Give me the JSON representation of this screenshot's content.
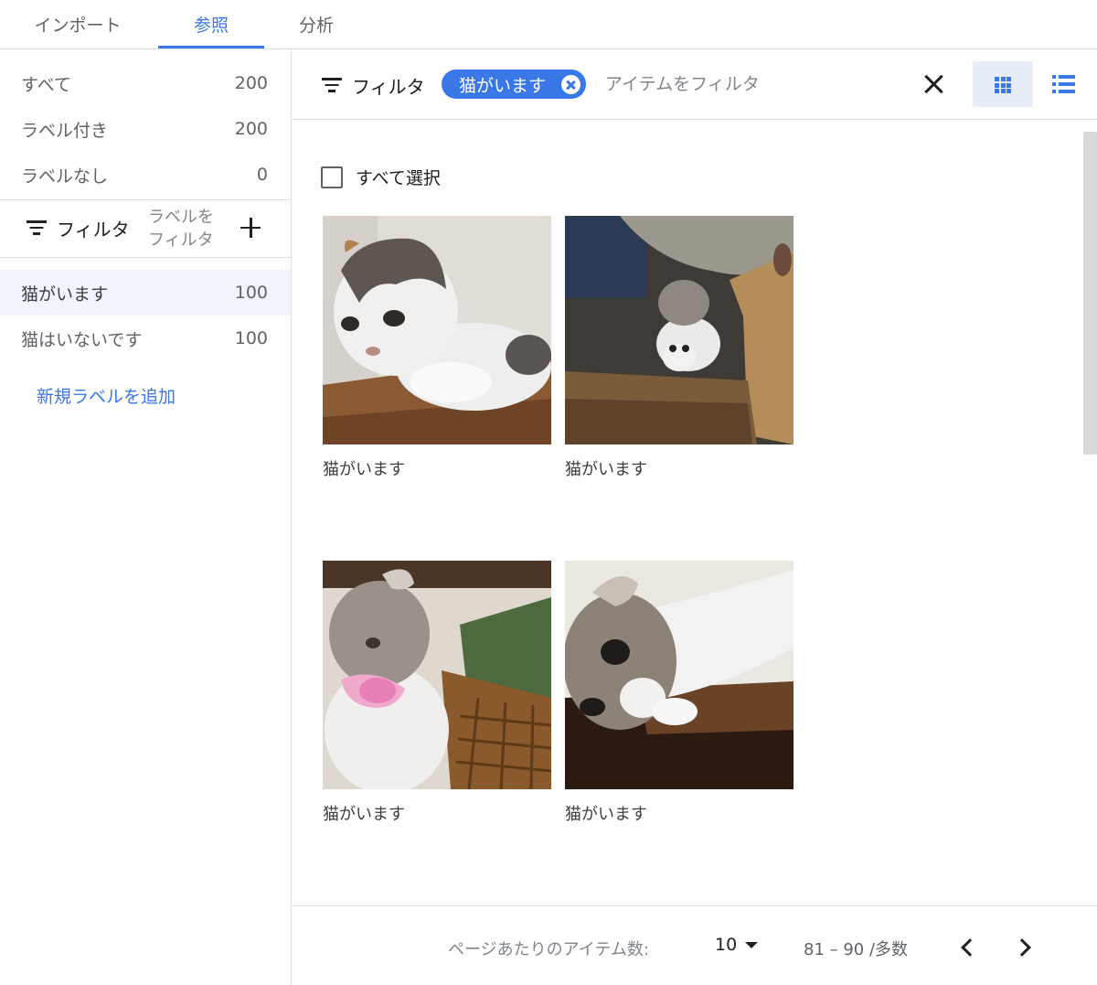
{
  "tabs": [
    {
      "label": "インポート"
    },
    {
      "label": "参照",
      "active": true
    },
    {
      "label": "分析"
    }
  ],
  "sidebar": {
    "summary": [
      {
        "label": "すべて",
        "count": "200"
      },
      {
        "label": "ラベル付き",
        "count": "200"
      },
      {
        "label": "ラベルなし",
        "count": "0"
      }
    ],
    "filter": {
      "label": "フィルタ",
      "placeholder": "ラベルを フィルタ",
      "add_icon": "plus-icon"
    },
    "labels": [
      {
        "label": "猫がいます",
        "count": "100",
        "selected": true
      },
      {
        "label": "猫はいないです",
        "count": "100",
        "selected": false
      }
    ],
    "add_label_link": "新規ラベルを追加"
  },
  "toolbar": {
    "filter_label": "フィルタ",
    "chip_label": "猫がいます",
    "input_placeholder": "アイテムをフィルタ",
    "input_value": "",
    "icons": [
      "filter-icon",
      "close-icon",
      "grid-view-icon",
      "list-view-icon"
    ]
  },
  "content": {
    "select_all": "すべて選択",
    "items": [
      {
        "caption": "猫がいます"
      },
      {
        "caption": "猫がいます"
      },
      {
        "caption": "猫がいます"
      },
      {
        "caption": "猫がいます"
      }
    ]
  },
  "pagination": {
    "per_page_label": "ページあたりのアイテム数:",
    "per_page_value": "10",
    "range": "81 – 90 /多数"
  },
  "colors": {
    "accent": "#3b78e7",
    "selected_bg": "#f1f4fb",
    "divider": "#dadce0"
  }
}
